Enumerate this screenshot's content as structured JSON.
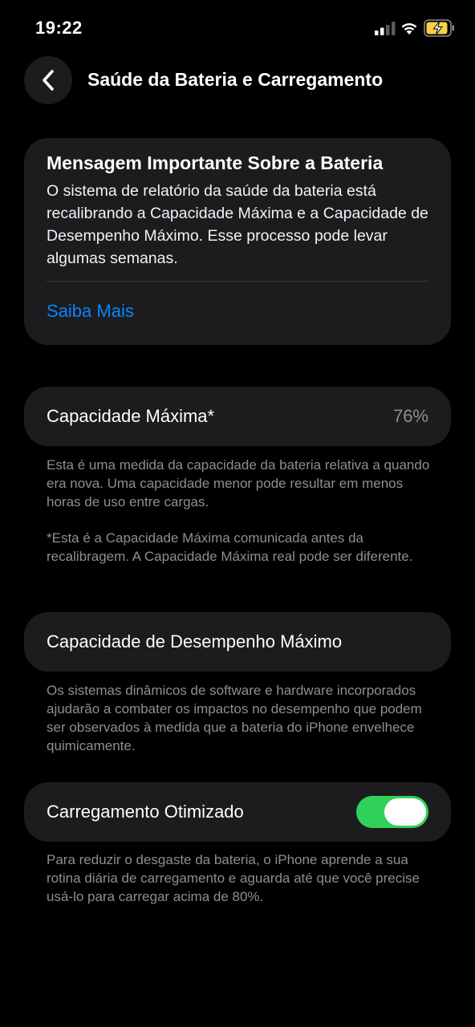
{
  "status_bar": {
    "time": "19:22",
    "icons": [
      "signal-icon",
      "wifi-icon",
      "battery-charging-icon"
    ],
    "battery_color": "#f7d047"
  },
  "nav": {
    "back_icon": "chevron-left-icon",
    "title": "Saúde da Bateria e Carregamento"
  },
  "message": {
    "title": "Mensagem Importante Sobre a Bateria",
    "body": "O sistema de relatório da saúde da bateria está recalibrando a Capacidade Máxima e a Capacidade de Desempenho Máximo. Esse processo pode levar algumas semanas.",
    "link": "Saiba Mais",
    "link_color": "#0a84ff"
  },
  "max_capacity": {
    "label": "Capacidade Máxima*",
    "value": "76%",
    "footnote_1": "Esta é uma medida da capacidade da bateria relativa a quando era nova. Uma capacidade menor pode resultar em menos horas de uso entre cargas.",
    "footnote_2": "*Esta é a Capacidade Máxima comunicada antes da recalibragem. A Capacidade Máxima real pode ser diferente."
  },
  "peak_performance": {
    "label": "Capacidade de Desempenho Máximo",
    "footnote": "Os sistemas dinâmicos de software e hardware incorporados ajudarão a combater os impactos no desempenho que podem ser observados à medida que a bateria do iPhone envelhece quimicamente."
  },
  "optimized_charging": {
    "label": "Carregamento Otimizado",
    "enabled": true,
    "toggle_color": "#30d158",
    "footnote": "Para reduzir o desgaste da bateria, o iPhone aprende a sua rotina diária de carregamento e aguarda até que você precise usá-lo para carregar acima de 80%."
  }
}
